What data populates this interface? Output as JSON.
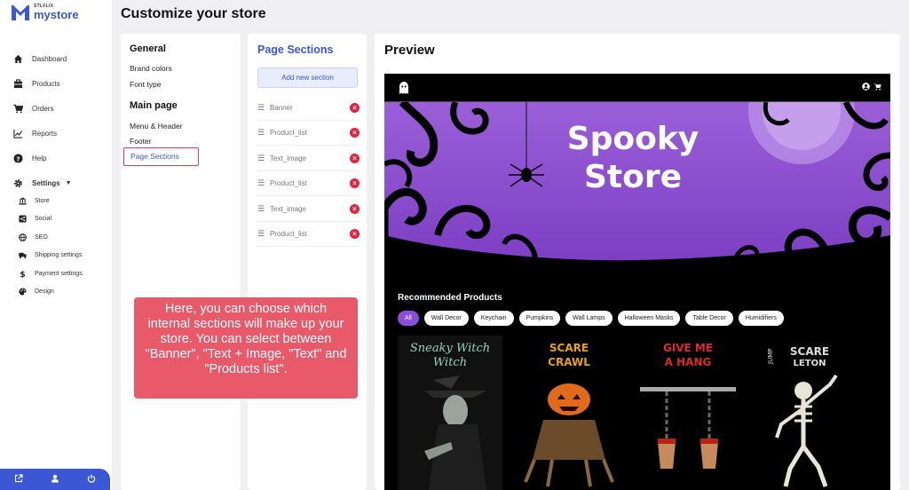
{
  "brand": {
    "small": "STLFLIX",
    "name": "mystore",
    "accent": "#3b57d4"
  },
  "sidebar": {
    "items": [
      {
        "label": "Dashboard",
        "icon": "home-icon"
      },
      {
        "label": "Products",
        "icon": "box-icon"
      },
      {
        "label": "Orders",
        "icon": "cart-icon"
      },
      {
        "label": "Reports",
        "icon": "chart-icon"
      },
      {
        "label": "Help",
        "icon": "help-icon"
      },
      {
        "label": "Settings",
        "icon": "gear-icon"
      }
    ],
    "settings_sub": [
      {
        "label": "Store",
        "icon": "bank-icon"
      },
      {
        "label": "Social",
        "icon": "share-icon"
      },
      {
        "label": "SEO",
        "icon": "globe-icon"
      },
      {
        "label": "Shipping settings",
        "icon": "truck-icon"
      },
      {
        "label": "Payment settings",
        "icon": "dollar-icon"
      },
      {
        "label": "Design",
        "icon": "palette-icon"
      }
    ],
    "bottom_icons": [
      "external-link-icon",
      "user-icon",
      "power-icon"
    ]
  },
  "header": {
    "title": "Customize your store"
  },
  "settings_panel": {
    "general_heading": "General",
    "general_links": [
      "Brand colors",
      "Font type"
    ],
    "main_heading": "Main page",
    "main_links": [
      "Menu & Header",
      "Footer",
      "Page Sections"
    ]
  },
  "sections_panel": {
    "title": "Page Sections",
    "add_label": "Add new section",
    "sections": [
      "Banner",
      "Product_list",
      "Text_image",
      "Product_list",
      "Text_image",
      "Product_list"
    ]
  },
  "preview": {
    "title": "Preview",
    "banner_title": "Spooky Store",
    "recommended_title": "Recommended Products",
    "chips": [
      "All",
      "Wall Decor",
      "Keychain",
      "Pumpkins",
      "Wall Lamps",
      "Halloween Masks",
      "Table Decor",
      "Humidifiers"
    ],
    "products": [
      "Sneaky Witch",
      "Scare Crawl",
      "Give Me A Hang",
      "Jump Scareleton"
    ]
  },
  "tooltip": {
    "text": "Here, you can choose which internal sections will make up your store. You can select between \"Banner\", \"Text + Image, \"Text\" and \"Products list\"."
  }
}
